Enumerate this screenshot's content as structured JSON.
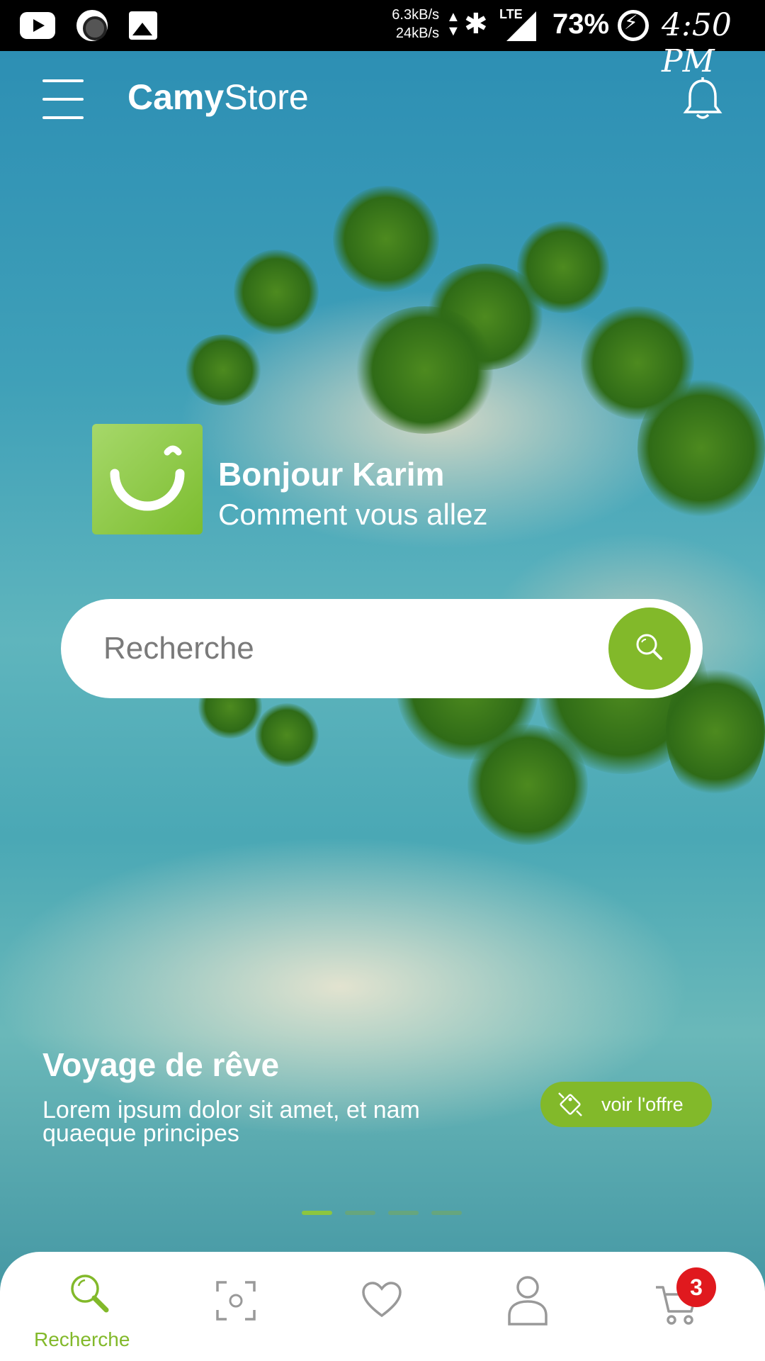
{
  "status_bar": {
    "speed_down": "6.3kB/s",
    "speed_up": "24kB/s",
    "network": "LTE",
    "battery": "73%",
    "time": "4:50 PM"
  },
  "header": {
    "brand_bold": "Camy",
    "brand_rest": "Store"
  },
  "greeting": {
    "name": "Bonjour Karim",
    "subtitle": "Comment vous allez"
  },
  "search": {
    "placeholder": "Recherche"
  },
  "promo": {
    "title": "Voyage de rêve",
    "description": "Lorem ipsum dolor sit amet, et nam quaeque principes",
    "button_label": "voir l'offre",
    "slides_total": 4,
    "slide_active": 1
  },
  "bottom_nav": {
    "active_label": "Recherche",
    "cart_badge": "3"
  },
  "colors": {
    "accent": "#82b92a",
    "badge": "#e0191e"
  }
}
